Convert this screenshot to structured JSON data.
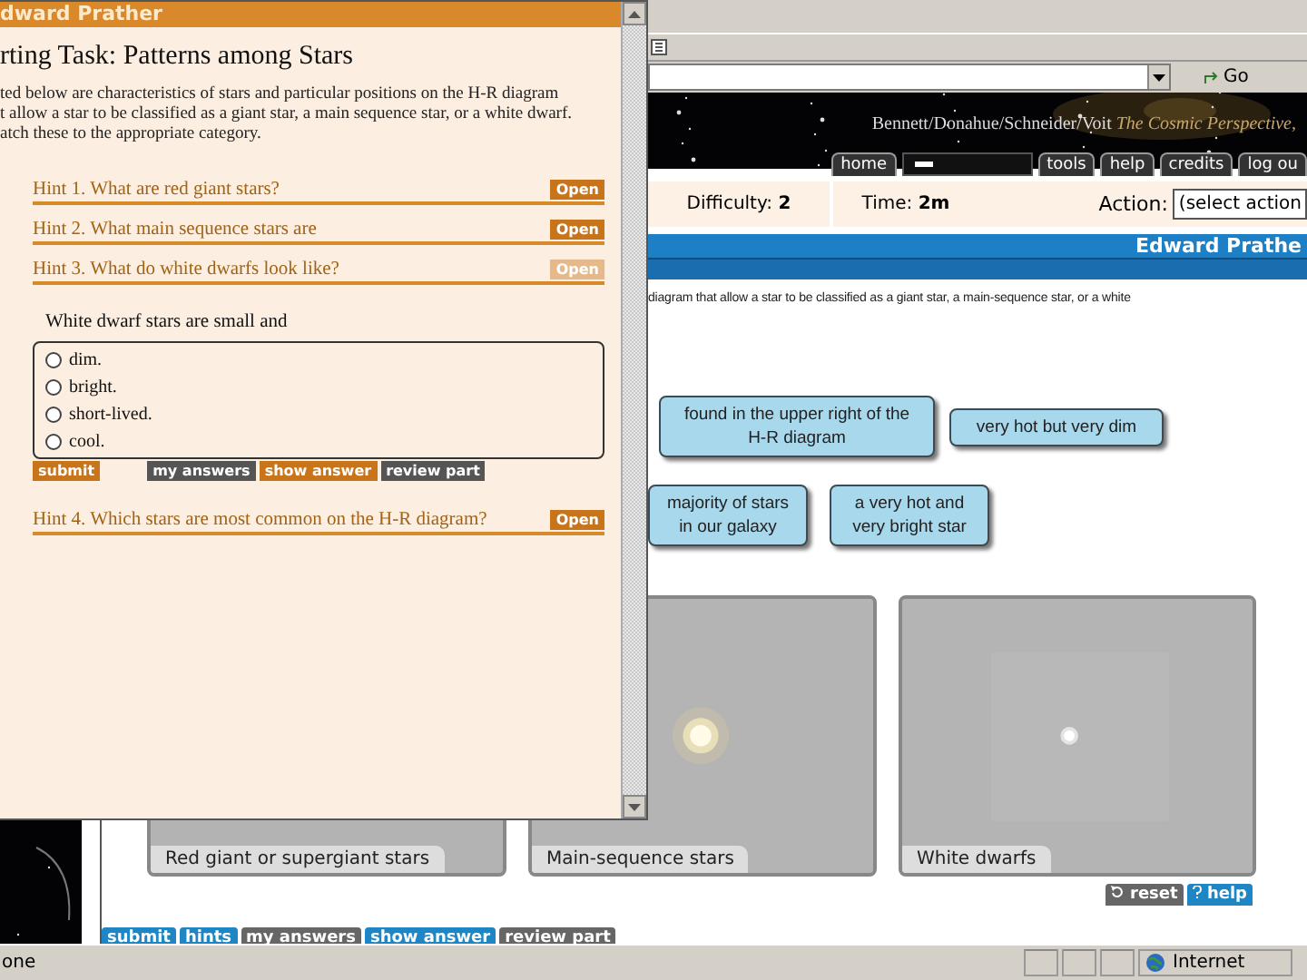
{
  "browser": {
    "go": "Go",
    "status": "one",
    "zone": "Internet"
  },
  "header": {
    "authors": "Bennett/Donahue/Schneider/Voit",
    "book": "The Cosmic Perspective,",
    "tabs": [
      {
        "label": "home",
        "kind": "tab"
      },
      {
        "kind": "field"
      },
      {
        "label": "tools",
        "kind": "tab"
      },
      {
        "label": "help",
        "kind": "tab"
      },
      {
        "label": "credits",
        "kind": "tab"
      },
      {
        "label": "log ou",
        "kind": "tab"
      }
    ]
  },
  "info": {
    "difficulty_label": "Difficulty:",
    "difficulty": "2",
    "time_label": "Time:",
    "time": "2m",
    "action_label": "Action:",
    "action_value": "(select action"
  },
  "banner": "Edward Prathe",
  "instructions": "diagram that allow a star to be classified as a giant star, a main-sequence star, or a white",
  "item_rows": [
    [
      "found in the upper right of the H-R diagram",
      "very hot but very dim"
    ],
    [
      "majority of stars in our galaxy",
      "a very hot and very bright star"
    ]
  ],
  "bins": [
    {
      "label": "Red giant or supergiant stars",
      "kind": "empty"
    },
    {
      "label": "Main-sequence stars",
      "kind": "glow"
    },
    {
      "label": "White dwarfs",
      "kind": "dot"
    }
  ],
  "reset": "reset",
  "help": "help",
  "bottom_buttons": [
    {
      "label": "submit",
      "kind": "primary"
    },
    {
      "label": "hints",
      "kind": "primary"
    },
    {
      "label": "my answers",
      "kind": "secondary"
    },
    {
      "label": "show answer",
      "kind": "primary"
    },
    {
      "label": "review part",
      "kind": "secondary"
    }
  ],
  "popup": {
    "title": "dward Prather",
    "heading": "rting Task: Patterns among Stars",
    "intro": [
      "ted below are characteristics of stars and particular positions on the H-R diagram",
      "t allow a star to be classified as a giant star, a main sequence star, or a white dwarf.",
      "atch these to the appropriate category."
    ],
    "hints": [
      {
        "label": "Hint 1. What are red giant stars?",
        "open_label": "Open",
        "expanded": false
      },
      {
        "label": "Hint 2. What main sequence stars are",
        "open_label": "Open",
        "expanded": false
      },
      {
        "label": "Hint 3. What do white dwarfs look like?",
        "open_label": "Open",
        "expanded": true,
        "question": "White dwarf stars are small and",
        "options": [
          {
            "label": "dim.",
            "selected": false
          },
          {
            "label": "bright.",
            "selected": false
          },
          {
            "label": "short-lived.",
            "selected": false
          },
          {
            "label": "cool.",
            "selected": false
          }
        ],
        "buttons": [
          {
            "label": "submit",
            "kind": "primary"
          },
          {
            "label": "my answers",
            "kind": "secondary"
          },
          {
            "label": "show answer",
            "kind": "primary"
          },
          {
            "label": "review part",
            "kind": "secondary"
          }
        ]
      },
      {
        "label": "Hint 4. Which stars are most common on the H-R diagram?",
        "open_label": "Open",
        "expanded": false
      }
    ]
  }
}
